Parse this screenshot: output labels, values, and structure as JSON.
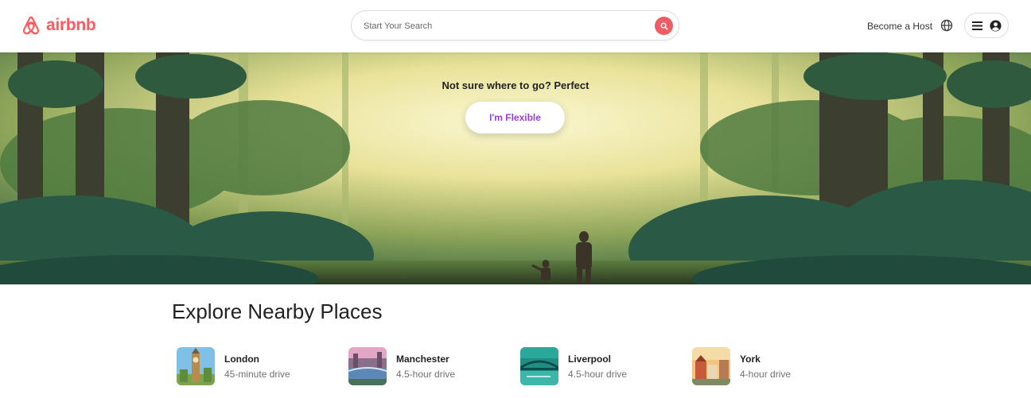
{
  "brand": {
    "name": "airbnb",
    "color": "#ff5a5f"
  },
  "search": {
    "placeholder": "Start Your Search",
    "button_icon": "search-icon",
    "button_color": "#ef5d62"
  },
  "nav": {
    "become_host": "Become a Host",
    "globe_icon": "globe-icon",
    "menu_icon": "hamburger-icon",
    "user_icon": "user-circle-icon"
  },
  "hero": {
    "tagline": "Not sure where to go? Perfect",
    "button_label": "I'm Flexible",
    "button_color": "#9b3fd3"
  },
  "explore": {
    "title": "Explore Nearby Places",
    "places": [
      {
        "name": "London",
        "drive": "45-minute drive"
      },
      {
        "name": "Manchester",
        "drive": "4.5-hour drive"
      },
      {
        "name": "Liverpool",
        "drive": "4.5-hour drive"
      },
      {
        "name": "York",
        "drive": "4-hour drive"
      }
    ]
  }
}
